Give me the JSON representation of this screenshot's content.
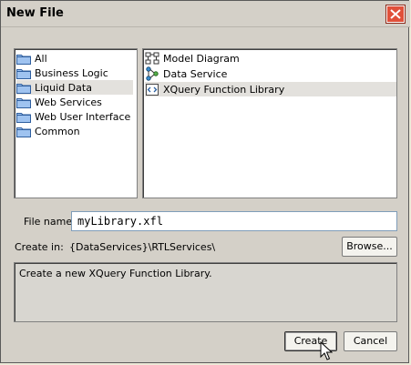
{
  "window": {
    "title": "New File"
  },
  "categories": [
    {
      "label": "All",
      "selected": false
    },
    {
      "label": "Business Logic",
      "selected": false
    },
    {
      "label": "Liquid Data",
      "selected": true
    },
    {
      "label": "Web Services",
      "selected": false
    },
    {
      "label": "Web User Interface",
      "selected": false
    },
    {
      "label": "Common",
      "selected": false
    }
  ],
  "file_types": [
    {
      "label": "Model Diagram",
      "icon": "model-diagram-icon",
      "selected": false
    },
    {
      "label": "Data Service",
      "icon": "data-service-icon",
      "selected": false
    },
    {
      "label": "XQuery Function Library",
      "icon": "xquery-library-icon",
      "selected": true
    }
  ],
  "form": {
    "file_name_label": "File name:",
    "file_name_value": "myLibrary.xfl",
    "create_in_label": "Create in:",
    "create_in_value": "{DataServices}\\RTLServices\\",
    "browse_label": "Browse..."
  },
  "description": "Create a new XQuery Function Library.",
  "buttons": {
    "create": "Create",
    "cancel": "Cancel"
  }
}
